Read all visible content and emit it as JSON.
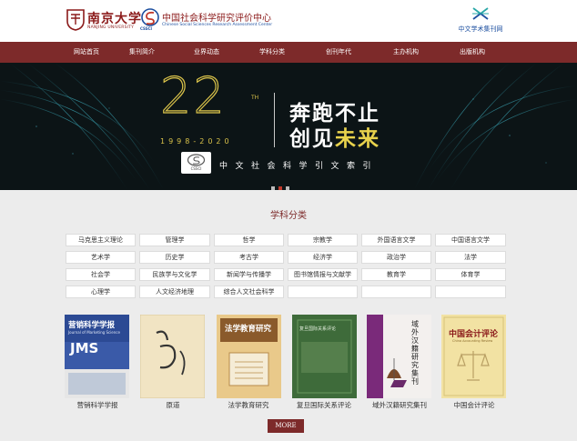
{
  "header": {
    "nju_name": "南京大学",
    "nju_sub": "NANJING UNIVERSITY",
    "cssci_emblem_text": "CSSCI",
    "cssci_cn": "中国社会科学研究评价中心",
    "cssci_en": "Chinese Social Sciences Research Assessment Center",
    "ccj_text": "中文学术集刊网"
  },
  "nav": {
    "items": [
      "网站首页",
      "集刊简介",
      "业界动态",
      "学科分类",
      "创刊年代",
      "主办机构",
      "出版机构"
    ]
  },
  "banner": {
    "big_number": "22",
    "superscript": "TH",
    "years": "1998-2020",
    "line1": "奔跑不止",
    "line2_prefix": "创见",
    "line2_highlight": "未来",
    "logo_label": "CSSCI",
    "index_text": "中文社会科学引文索引",
    "slides": 3,
    "active_slide": 1
  },
  "subjects": {
    "title": "学科分类",
    "rows": [
      [
        "马克思主义理论",
        "管理学",
        "哲学",
        "宗教学",
        "外国语言文学",
        "中国语言文学"
      ],
      [
        "艺术学",
        "历史学",
        "考古学",
        "经济学",
        "政治学",
        "法学"
      ],
      [
        "社会学",
        "民族学与文化学",
        "新闻学与传播学",
        "图书馆情报与文献学",
        "教育学",
        "体育学"
      ],
      [
        "心理学",
        "人文经济地理",
        "综合人文社会科学",
        "",
        "",
        ""
      ]
    ]
  },
  "books": [
    {
      "title": "营销科学学报",
      "cover_main": "营销科学学报",
      "cover_en": "Journal of Marketing Science",
      "cover_abbr": "JMS"
    },
    {
      "title": "原道",
      "cover_main": "原道"
    },
    {
      "title": "法学教育研究",
      "cover_main": "法学教育研究"
    },
    {
      "title": "复旦国际关系评论",
      "cover_main": "复旦国际关系评论"
    },
    {
      "title": "域外汉籍研究集刊",
      "cover_main": "域外汉籍研究集刊"
    },
    {
      "title": "中国会计评论",
      "cover_main": "中国会计评论",
      "cover_en": "China Accounting Review"
    }
  ],
  "more_label": "MORE",
  "colors": {
    "brand": "#7d2a2a",
    "banner_bg": "#0c1416",
    "gold": "#d9c24a",
    "section_bg": "#ececec",
    "active_dot": "#c0392b"
  }
}
